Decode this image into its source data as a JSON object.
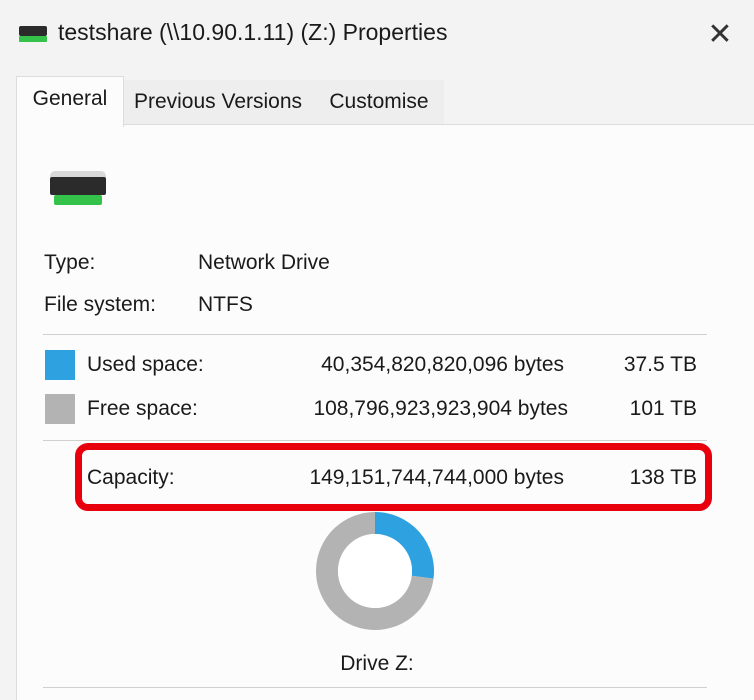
{
  "window": {
    "title": "testshare (\\\\10.90.1.11) (Z:) Properties",
    "close_glyph": "✕"
  },
  "tabs": [
    {
      "label": "General",
      "active": true
    },
    {
      "label": "Previous Versions",
      "active": false
    },
    {
      "label": "Customise",
      "active": false
    }
  ],
  "drive": {
    "icon": "network-drive-icon",
    "type_label": "Type:",
    "type_value": "Network Drive",
    "fs_label": "File system:",
    "fs_value": "NTFS"
  },
  "space": {
    "used": {
      "label": "Used space:",
      "bytes": "40,354,820,820,096 bytes",
      "size": "37.5 TB",
      "color": "#2ea1e0"
    },
    "free": {
      "label": "Free space:",
      "bytes": "108,796,923,923,904 bytes",
      "size": "101 TB",
      "color": "#b3b3b3"
    },
    "capacity": {
      "label": "Capacity:",
      "bytes": "149,151,744,744,000 bytes",
      "size": "138 TB"
    }
  },
  "chart_data": {
    "type": "pie",
    "categories": [
      "Used space",
      "Free space"
    ],
    "values": [
      40354820820096,
      108796923923904
    ],
    "colors": [
      "#2ea1e0",
      "#b3b3b3"
    ]
  },
  "drive_caption": "Drive Z:",
  "highlight_color": "#e8000d"
}
